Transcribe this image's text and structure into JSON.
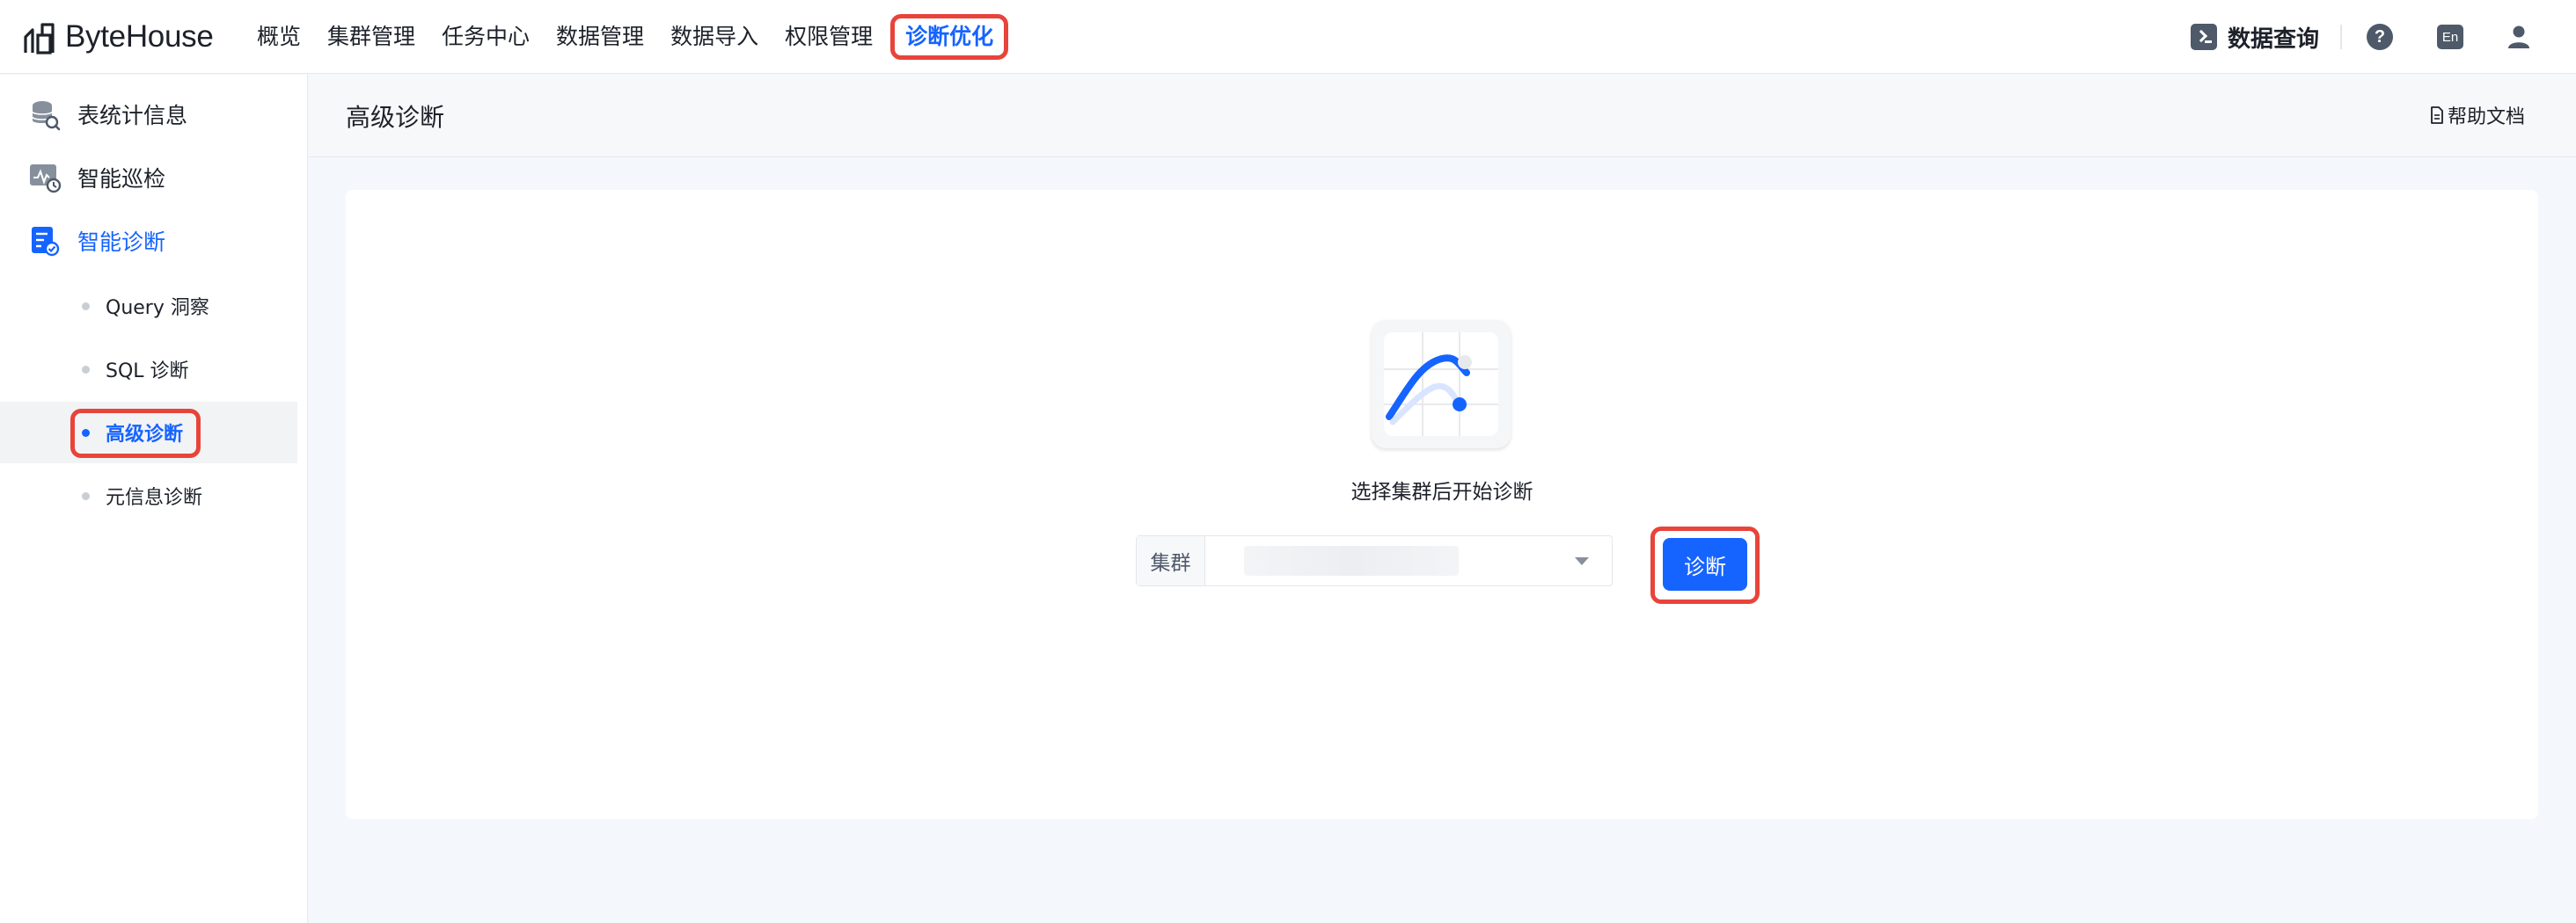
{
  "app": {
    "brand": "ByteHouse"
  },
  "nav": {
    "items": [
      "概览",
      "集群管理",
      "任务中心",
      "数据管理",
      "数据导入",
      "权限管理"
    ],
    "active": "诊断优化"
  },
  "topRight": {
    "query_label": "数据查询",
    "help_glyph": "?",
    "lang_label": "En"
  },
  "sidebar": {
    "items": [
      {
        "label": "表统计信息",
        "icon": "database-search-icon"
      },
      {
        "label": "智能巡检",
        "icon": "monitor-clock-icon"
      },
      {
        "label": "智能诊断",
        "icon": "diagnosis-doc-icon"
      }
    ],
    "subitems": [
      "Query 洞察",
      "SQL 诊断",
      "高级诊断",
      "元信息诊断"
    ],
    "selected_subitem": "高级诊断"
  },
  "header": {
    "title": "高级诊断",
    "help_doc": "帮助文档"
  },
  "main": {
    "hint": "选择集群后开始诊断",
    "cluster_label": "集群",
    "diagnose_button": "诊断"
  },
  "colors": {
    "accent": "#1664ff",
    "highlight": "#e8443a"
  }
}
